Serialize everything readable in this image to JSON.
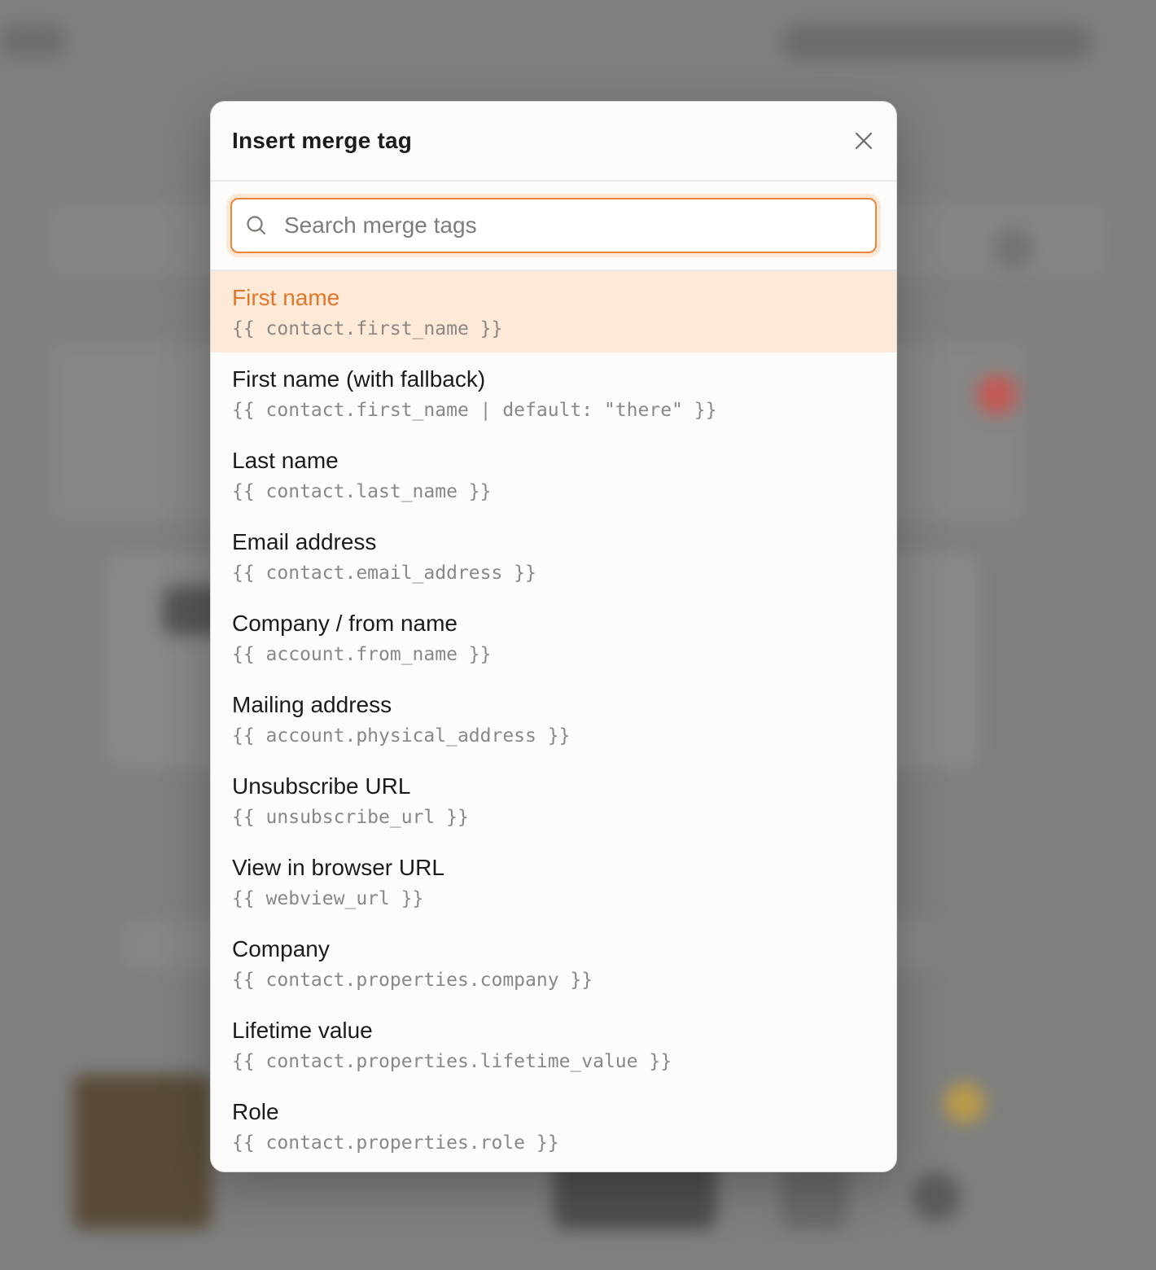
{
  "modal": {
    "title": "Insert merge tag",
    "close_icon": "close-icon"
  },
  "search": {
    "placeholder": "Search merge tags",
    "value": "",
    "icon": "search-icon"
  },
  "colors": {
    "accent": "#e8853a",
    "active_bg": "#fde9d8",
    "active_text": "#e2772a"
  },
  "items": [
    {
      "label": "First name",
      "tag": "{{ contact.first_name }}",
      "active": true
    },
    {
      "label": "First name (with fallback)",
      "tag": "{{ contact.first_name | default: \"there\" }}",
      "active": false
    },
    {
      "label": "Last name",
      "tag": "{{ contact.last_name }}",
      "active": false
    },
    {
      "label": "Email address",
      "tag": "{{ contact.email_address }}",
      "active": false
    },
    {
      "label": "Company / from name",
      "tag": "{{ account.from_name }}",
      "active": false
    },
    {
      "label": "Mailing address",
      "tag": "{{ account.physical_address }}",
      "active": false
    },
    {
      "label": "Unsubscribe URL",
      "tag": "{{ unsubscribe_url }}",
      "active": false
    },
    {
      "label": "View in browser URL",
      "tag": "{{ webview_url }}",
      "active": false
    },
    {
      "label": "Company",
      "tag": "{{ contact.properties.company }}",
      "active": false
    },
    {
      "label": "Lifetime value",
      "tag": "{{ contact.properties.lifetime_value }}",
      "active": false
    },
    {
      "label": "Role",
      "tag": "{{ contact.properties.role }}",
      "active": false
    }
  ]
}
